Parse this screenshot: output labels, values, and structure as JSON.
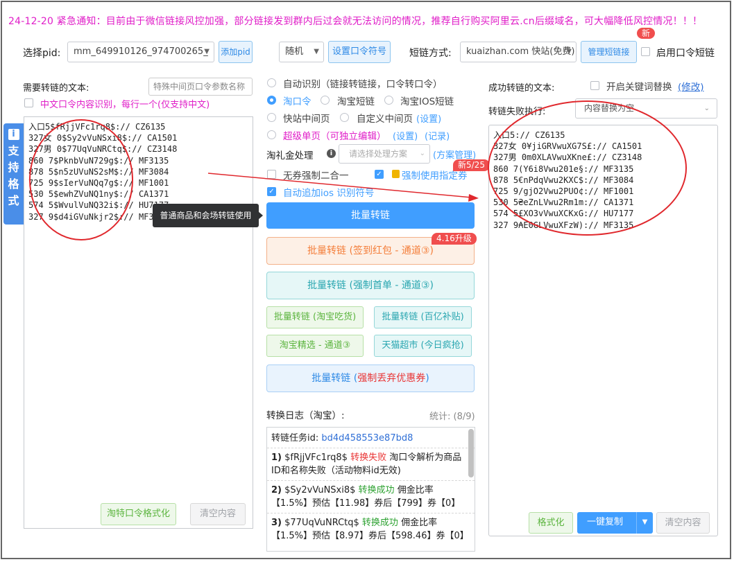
{
  "notice": "24-12-20 紧急通知：目前由于微信链接风控加强，部分链接发到群内后过会就无法访问的情况，推荐自行购买阿里云.cn后缀域名，可大幅降低风控情况！！！",
  "toolbar": {
    "pid_label": "选择pid:",
    "pid_value": "mm_649910126_974700265_",
    "add_pid": "添加pid",
    "mode_value": "随机",
    "set_pwd_symbol": "设置口令符号",
    "shortlink_label": "短链方式:",
    "shortlink_value": "kuaizhan.com 快站(免费)",
    "manage_shortlink": "管理短链接",
    "new_badge": "新",
    "use_pwd_shortlink": "启用口令短链"
  },
  "left": {
    "title": "需要转链的文本:",
    "param_placeholder": "特殊中间页口令参数名称",
    "cn_recognize": "中文口令内容识别，每行一个(仅支持中文)",
    "side_tab": "支持格式",
    "input_text": "入口5$fRjjVFc1rq8$:// CZ6135\n327女 0$Sy2vVuNSxi8$:// CA1501\n327男 0$77UqVuNRCtq$:// CZ3148\n860 7$PknbVuN729g$:// MF3135\n878 5$n5zUVuNS2sM$:// MF3084\n725 9$sIerVuNQq7g$:// MF1001\n530 5$ewhZVuNQ1ny$:// CA1371\n574 5$WvulVuNQ32i$:// HU7177\n327 9$d4iGVuNkjr2$:// MF3135",
    "format_btn": "淘特口令格式化",
    "clear_btn": "清空内容"
  },
  "middle": {
    "radio_auto": "自动识别（链接转链接，口令转口令）",
    "radio_tkl": "淘口令",
    "radio_tb_short": "淘宝短链",
    "radio_ios_short": "淘宝IOS短链",
    "radio_kz_mid": "快站中间页",
    "radio_custom_mid": "自定义中间页",
    "setting": "(设置)",
    "radio_super": "超级单页（可独立编辑）",
    "setting2": "(设置)",
    "record": "(记录)",
    "tlj_label": "淘礼金处理",
    "tlj_placeholder": "请选择处理方案",
    "scheme_mgmt": "(方案管理)",
    "no_coupon": "无券强制二合一",
    "force_coupon": "强制使用指定券",
    "new_tag": "新5/25",
    "auto_ios": "自动追加ios 识别符号",
    "tooltip": "普通商品和会场转链使用",
    "batch": "批量转链",
    "upgrade_tag": "4.16升级",
    "batch_redpack": "批量转链 (签到红包 - 通道③)",
    "batch_first": "批量转链 (强制首单 - 通道③)",
    "batch_taote": "批量转链 (淘宝吃货)",
    "batch_baiyi": "批量转链 (百亿补贴)",
    "tb_jingxuan": "淘宝精选 - 通道③",
    "tmall_super": "天猫超市 (今日疯抢)",
    "batch_drop_prefix": "批量转链 (",
    "batch_drop_red": "强制丢弃优惠券",
    "batch_drop_suffix": ")"
  },
  "log": {
    "title": "转换日志（淘宝）:",
    "stats": "统计: (8/9)",
    "task_label": "转链任务id:",
    "task_id": "bd4d458553e87bd8",
    "entries": [
      {
        "num": "1)",
        "code": "$fRjjVFc1rq8$",
        "status": "转换失败",
        "status_type": "fail",
        "detail": "淘口令解析为商品ID和名称失败（活动物料id无效)"
      },
      {
        "num": "2)",
        "code": "$Sy2vVuNSxi8$",
        "status": "转换成功",
        "status_type": "ok",
        "detail": "佣金比率【1.5%】预估【11.98】券后【799】券【0】"
      },
      {
        "num": "3)",
        "code": "$77UqVuNRCtq$",
        "status": "转换成功",
        "status_type": "ok",
        "detail": "佣金比率【1.5%】预估【8.97】券后【598.46】券【0】"
      }
    ]
  },
  "right": {
    "title": "成功转链的文本:",
    "keyword_replace": "开启关键词替换",
    "modify": "(修改)",
    "fail_label": "转链失败执行:",
    "fail_value": "内容替换为空",
    "output_text": "入口5:// CZ6135\n327女 0¥jiGRVwuXG7S£:// CA1501\n327男 0m0XLAVwuXKne£:// CZ3148\n860 7(Y6i8Vwu201e§:// MF3135\n878 5€nPdqVwu2KXC$:// MF3084\n725 9/gjO2Vwu2PUO¢:// MF1001\n530 5₴eZnLVwu2Rm1m:// CA1371\n574 5£XO3vVwuXCKxG:// HU7177\n327 9₳E0GLVwuXFzW):// MF3135",
    "format_btn": "格式化",
    "copy_btn": "一键复制",
    "clear_btn": "清空内容"
  },
  "colors": {
    "notice": "#e01ec8",
    "primary": "#409eff",
    "danger": "#e93535",
    "success": "#2ca130",
    "annotation": "#e0282d"
  }
}
